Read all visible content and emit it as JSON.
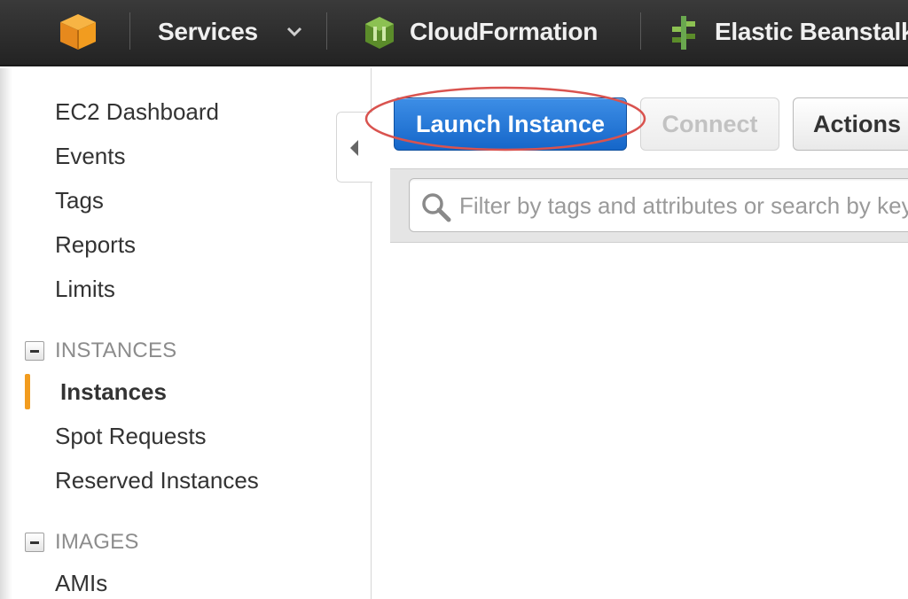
{
  "topbar": {
    "services_label": "Services",
    "cloudformation_label": "CloudFormation",
    "beanstalk_label": "Elastic Beanstalk",
    "colors": {
      "background": "#2b2b2b",
      "logo_orange": "#f29c1f",
      "cf_green": "#6aa84f"
    }
  },
  "sidebar": {
    "top_items": [
      "EC2 Dashboard",
      "Events",
      "Tags",
      "Reports",
      "Limits"
    ],
    "sections": [
      {
        "title": "INSTANCES",
        "items": [
          "Instances",
          "Spot Requests",
          "Reserved Instances"
        ],
        "active": "Instances"
      },
      {
        "title": "IMAGES",
        "items": [
          "AMIs"
        ]
      }
    ],
    "active_color": "#f29c1f"
  },
  "toolbar": {
    "launch_label": "Launch Instance",
    "connect_label": "Connect",
    "actions_label": "Actions",
    "launch_color": "#1f73d6",
    "highlight_color": "#d9534f"
  },
  "search": {
    "placeholder": "Filter by tags and attributes or search by keyword"
  }
}
